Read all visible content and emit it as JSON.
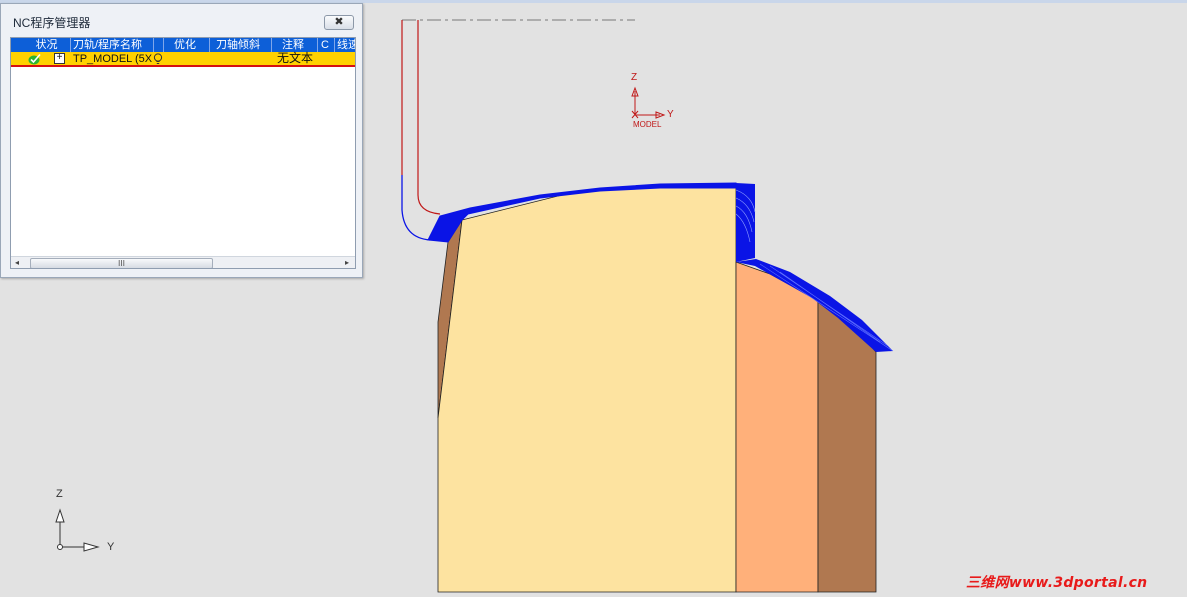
{
  "nc_manager": {
    "title": "NC程序管理器",
    "close_glyph": "✖",
    "columns": [
      "状况",
      "刀轨/程序名称",
      "",
      "优化",
      "刀轴倾斜",
      "注释",
      "C",
      "线速"
    ],
    "rows": [
      {
        "status_icon": "check-icon",
        "expand_glyph": "+",
        "name": "TP_MODEL (5X",
        "comment": "无文本"
      }
    ],
    "scrollbar": {
      "left": "◂",
      "right": "▸",
      "grip": "III"
    }
  },
  "viewport": {
    "model_axis": {
      "z": "Z",
      "y": "Y",
      "label": "MODEL"
    },
    "world_axis": {
      "z": "Z",
      "y": "Y"
    },
    "colors": {
      "background": "#e2e2e2",
      "part_main": "#fde3a0",
      "part_side": "#b07850",
      "part_mid": "#ffb07a",
      "toolpath": "#0a14e6",
      "tool_line": "#c01818"
    }
  },
  "watermark": "三维网www.3dportal.cn"
}
